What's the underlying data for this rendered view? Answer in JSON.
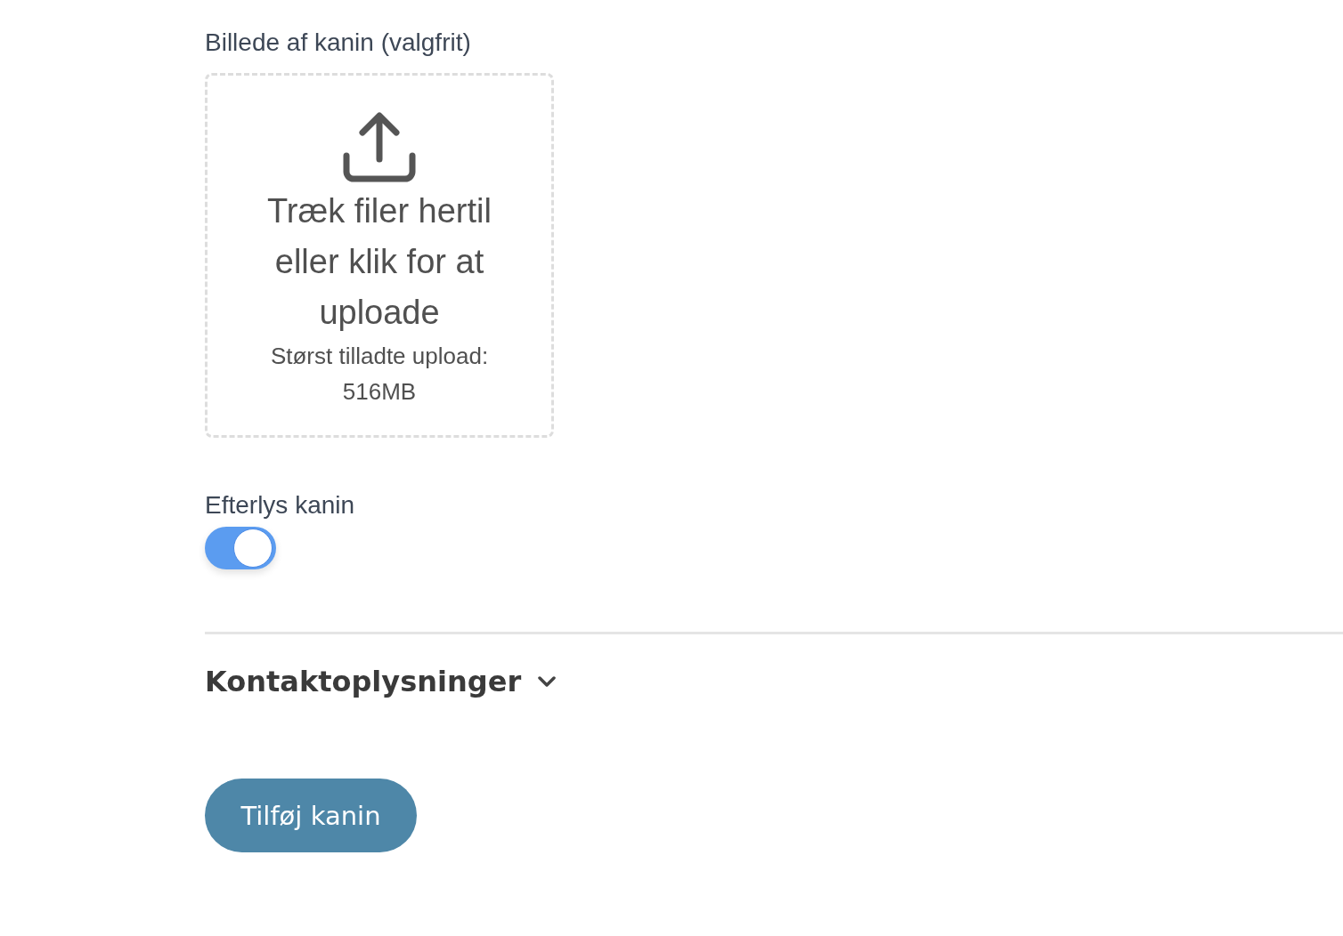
{
  "upload": {
    "label": "Billede af kanin (valgfrit)",
    "prompt": "Træk filer hertil eller klik for at uploade",
    "limit": "Størst tilladte upload: 516MB"
  },
  "toggle": {
    "label": "Efterlys kanin",
    "on": true
  },
  "section": {
    "title": "Kontaktoplysninger",
    "expanded": false
  },
  "submit": {
    "label": "Tilføj kanin"
  }
}
